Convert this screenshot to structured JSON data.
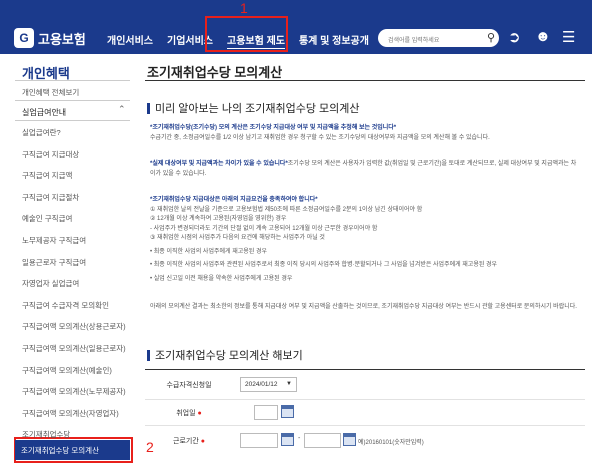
{
  "header": {
    "logo_mark": "G",
    "logo_text": "고용보험",
    "nav": [
      "개인서비스",
      "기업서비스",
      "고용보험 제도",
      "통계 및 정보공개"
    ],
    "search_placeholder": "검색어를 입력하세요"
  },
  "annotations": {
    "one": "1",
    "two": "2"
  },
  "sidebar": {
    "title": "개인혜택",
    "all_view": "개인혜택 전체보기",
    "section": "실업급여안내",
    "items": [
      "실업급여란?",
      "구직급여 지급대상",
      "구직급여 지급액",
      "구직급여 지급절차",
      "예술인 구직급여",
      "노무제공자 구직급여",
      "일용근로자 구직급여",
      "자영업자 실업급여",
      "구직급여 수급자격 모의확인",
      "구직급여액 모의계산(상용근로자)",
      "구직급여액 모의계산(일용근로자)",
      "구직급여액 모의계산(예술인)",
      "구직급여액 모의계산(노무제공자)",
      "구직급여액 모의계산(자영업자)",
      "조기재취업수당"
    ],
    "active_item": "조기재취업수당 모의계산"
  },
  "main": {
    "title": "조기재취업수당 모의계산",
    "section1": "미리 알아보는 나의 조기재취업수당 모의계산",
    "p1_em": "*조기재취업수당(조기수당) 모의 계산은 조기수당 지급대상 여부 및 지급액을 추정해 보는 것입니다*",
    "p1": "수급기간 중, 소정급여일수를 1/2 이상 남기고 재취업한 경우 청구할 수 있는 조기수당의 대상여부와 지급액을 모의 계산해 볼 수 있습니다.",
    "p2_em": "*실제 대상여부 및 지급액과는 차이가 있을 수 있습니다*",
    "p2": "조기수당 모의 계산은 사용자가 입력한 값(취업일 및 근로기간)을 토대로 계산되므로, 실제 대상여부 및 지급액과는 차이가 있을 수 있습니다.",
    "p3_em": "*조기재취업수당 지급대상은 아래의 지급요건을 충족하여야 합니다*",
    "p3_lines": [
      "① 재취업한 날의 전날을 기준으로 고용보험법 제50조에 따른 소정급여일수를 2분의 1이상 남긴 상태이어야 함",
      "② 12개월 이상 계속하여 고용된(자영업을 영위한) 경우",
      "- 사업주가 변경되더라도 기간의 단절 없이 계속 고용되어 12개월 이상 근무한 경우이어야 함",
      "③ 재취업한 시점의 사업주가 다음의 요건에 해당하는 사업주가 아닐 것",
      "• 최종 이직한 사업의 사업주에게 재고용된 경우",
      "• 최종 이직한 사업의 사업주와 관련된 사업주로서 최종 이직 당시의 사업주와 합병·분할되거나 그 사업을 넘겨받은 사업주에게 재고용된 경우",
      "• 실업 신고일 이전 채용을 약속한 사업주에게 고용된 경우"
    ],
    "p4": "아래의 모의계산 결과는 최소한의 정보를 통해 지급대상 여부 및 지급액을 산출하는 것이므로, 조기재취업수당 지급대상 여부는 반드시 관할 고용센터로 문의하시기 바랍니다.",
    "section2": "조기재취업수당 모의계산 해보기",
    "form": {
      "base_date_label": "수급자격신청일",
      "base_date_value": "2024/01/12",
      "job_date_label": "취업일",
      "period_label": "근로기간",
      "period_sep": "-",
      "period_hint": "예)20160101(숫자만입력)"
    }
  }
}
